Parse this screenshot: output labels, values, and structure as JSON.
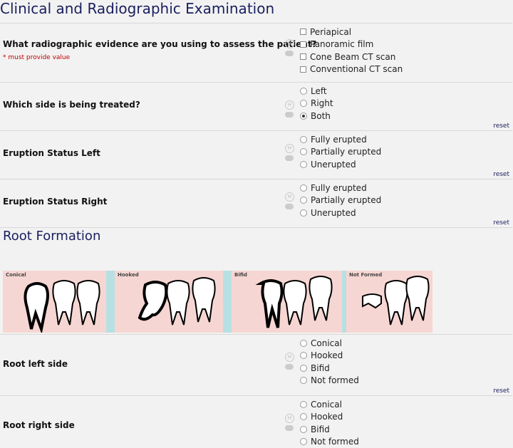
{
  "section1": {
    "title": "Clinical and Radiographic Examination"
  },
  "q1": {
    "label": "What radiographic evidence are you using to assess the patient?",
    "required": "* must provide value",
    "options": [
      "Periapical",
      "Panoramic film",
      "Cone Beam CT scan",
      "Conventional CT scan"
    ],
    "checked": [
      false,
      false,
      false,
      false
    ]
  },
  "q2": {
    "label": "Which side is being treated?",
    "options": [
      "Left",
      "Right",
      "Both"
    ],
    "selected": "Both",
    "reset": "reset"
  },
  "q3": {
    "label": "Eruption Status Left",
    "options": [
      "Fully erupted",
      "Partially erupted",
      "Unerupted"
    ],
    "selected": "",
    "reset": "reset"
  },
  "q4": {
    "label": "Eruption Status Right",
    "options": [
      "Fully erupted",
      "Partially erupted",
      "Unerupted"
    ],
    "selected": "",
    "reset": "reset"
  },
  "section2": {
    "title": "Root Formation",
    "image_labels": [
      "Conical",
      "Hooked",
      "Bifid",
      "Not Formed"
    ]
  },
  "q5": {
    "label": "Root left side",
    "options": [
      "Conical",
      "Hooked",
      "Bifid",
      "Not formed"
    ],
    "selected": "",
    "reset": "reset"
  },
  "q6": {
    "label": "Root right side",
    "options": [
      "Conical",
      "Hooked",
      "Bifid",
      "Not formed"
    ],
    "selected": ""
  },
  "colors": {
    "heading": "#1a1f5e",
    "required": "#c00000",
    "tooth_bg": "#f7c9c6"
  },
  "icons": {
    "history": "history-icon",
    "comment": "comment-icon"
  }
}
